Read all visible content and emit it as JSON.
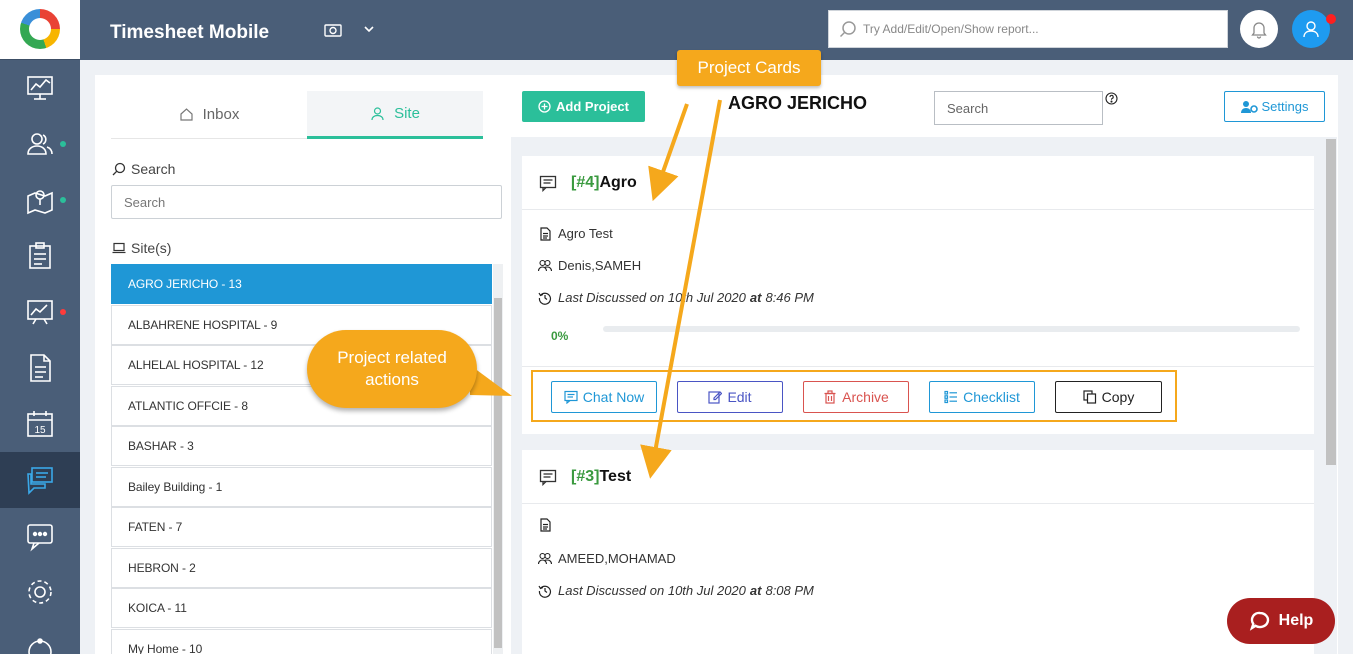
{
  "app": {
    "title": "Timesheet Mobile"
  },
  "topbar": {
    "search_placeholder": "Try Add/Edit/Open/Show report..."
  },
  "rail": {
    "items": [
      "dashboard-chart",
      "users",
      "map-location",
      "clipboard-list",
      "analytics",
      "document",
      "calendar",
      "chat",
      "message-dots",
      "settings",
      "more"
    ],
    "calendar_day": "15",
    "dot_colors": {
      "green": "#2bbf9a",
      "red": "#ff3b3b"
    }
  },
  "tabs": {
    "inbox": "Inbox",
    "site": "Site"
  },
  "sidebar": {
    "search_label": "Search",
    "search_placeholder": "Search",
    "sites_label": "Site(s)",
    "sites": [
      "AGRO JERICHO - 13",
      "ALBAHRENE HOSPITAL - 9",
      "ALHELAL HOSPITAL - 12",
      "ATLANTIC OFFCIE - 8",
      "BASHAR - 3",
      "Bailey Building - 1",
      "FATEN - 7",
      "HEBRON - 2",
      "KOICA - 11",
      "My Home - 10"
    ]
  },
  "main": {
    "add_project": "Add Project",
    "site_title": "AGRO JERICHO",
    "search_placeholder": "Search",
    "settings": "Settings"
  },
  "cards": [
    {
      "num": "[#4]",
      "name": "Agro",
      "description": "Agro Test",
      "members": "Denis,SAMEH",
      "last_discussed_prefix": "Last Discussed on 10th Jul 2020",
      "at": "at",
      "time": "8:46 PM",
      "progress_label": "0%",
      "progress": 0,
      "actions": {
        "chat": "Chat Now",
        "edit": "Edit",
        "archive": "Archive",
        "checklist": "Checklist",
        "copy": "Copy"
      }
    },
    {
      "num": "[#3]",
      "name": "Test",
      "description": "",
      "members": "AMEED,MOHAMAD",
      "last_discussed_prefix": "Last Discussed on 10th Jul 2020",
      "at": "at",
      "time": "8:08 PM"
    }
  ],
  "annotations": {
    "cards": "Project Cards",
    "actions_line1": "Project related",
    "actions_line2": "actions",
    "color": "#f5a81c"
  },
  "help": {
    "label": "Help"
  },
  "colors": {
    "rail": "#4a5e78",
    "accent_green": "#2bbf9a",
    "site_active": "#1f97d6",
    "archive": "#d9534f",
    "chat": "#1f97d6",
    "edit": "#4a55c4",
    "help": "#a91f1f"
  }
}
